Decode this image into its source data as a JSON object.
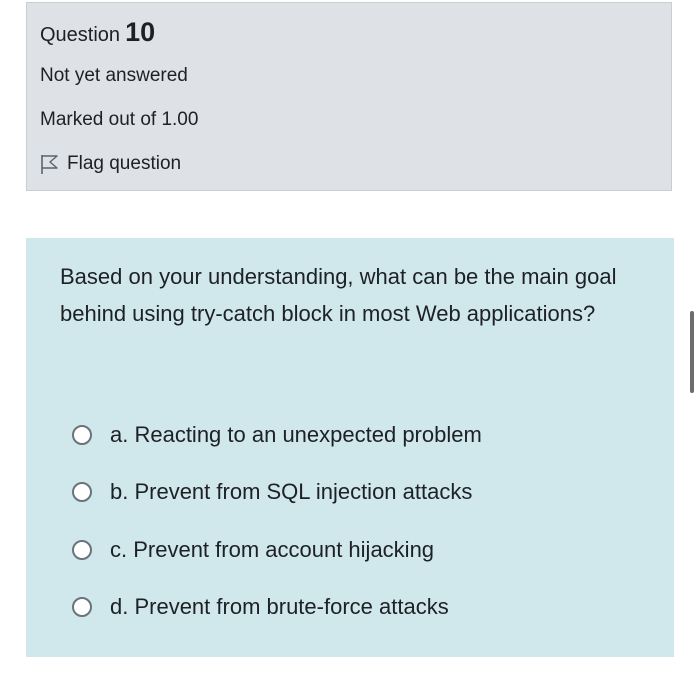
{
  "question_info": {
    "label": "Question",
    "number": "10",
    "state": "Not yet answered",
    "grade": "Marked out of 1.00",
    "flag_label": "Flag question"
  },
  "question": {
    "text": "Based on your understanding, what can be the main goal behind using try-catch block in most Web applications?",
    "answers": [
      {
        "label": "a. Reacting to an unexpected problem"
      },
      {
        "label": "b. Prevent from SQL injection attacks"
      },
      {
        "label": "c. Prevent from account hijacking"
      },
      {
        "label": "d. Prevent from brute-force attacks"
      }
    ]
  },
  "colors": {
    "info_bg": "#dee2e6",
    "content_bg": "#d0e7ec",
    "text": "#1d2125"
  },
  "icons": {
    "flag": "flag-outline-icon",
    "radio": "radio-unchecked-icon"
  }
}
